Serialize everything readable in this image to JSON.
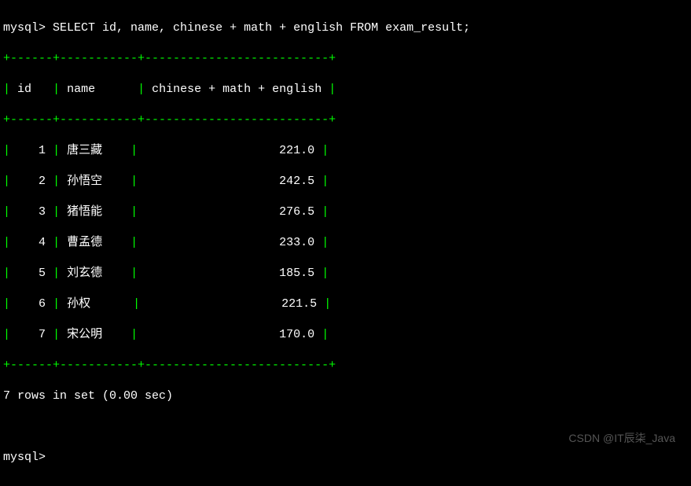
{
  "prompt": "mysql>",
  "query": "SELECT id, name, chinese + math + english FROM exam_result;",
  "table": {
    "border_top": "+------+-----------+--------------------------+",
    "border_mid": "+------+-----------+--------------------------+",
    "border_bottom": "+------+-----------+--------------------------+",
    "headers": {
      "id": "id",
      "name": "name",
      "expr": "chinese + math + english"
    },
    "rows": [
      {
        "id": "1",
        "name": "唐三藏",
        "sum": "221.0"
      },
      {
        "id": "2",
        "name": "孙悟空",
        "sum": "242.5"
      },
      {
        "id": "3",
        "name": "猪悟能",
        "sum": "276.5"
      },
      {
        "id": "4",
        "name": "曹孟德",
        "sum": "233.0"
      },
      {
        "id": "5",
        "name": "刘玄德",
        "sum": "185.5"
      },
      {
        "id": "6",
        "name": "孙权",
        "sum": "221.5"
      },
      {
        "id": "7",
        "name": "宋公明",
        "sum": "170.0"
      }
    ]
  },
  "status": "7 rows in set (0.00 sec)",
  "prompt2": "mysql>",
  "watermark": "CSDN @IT辰柒_Java"
}
